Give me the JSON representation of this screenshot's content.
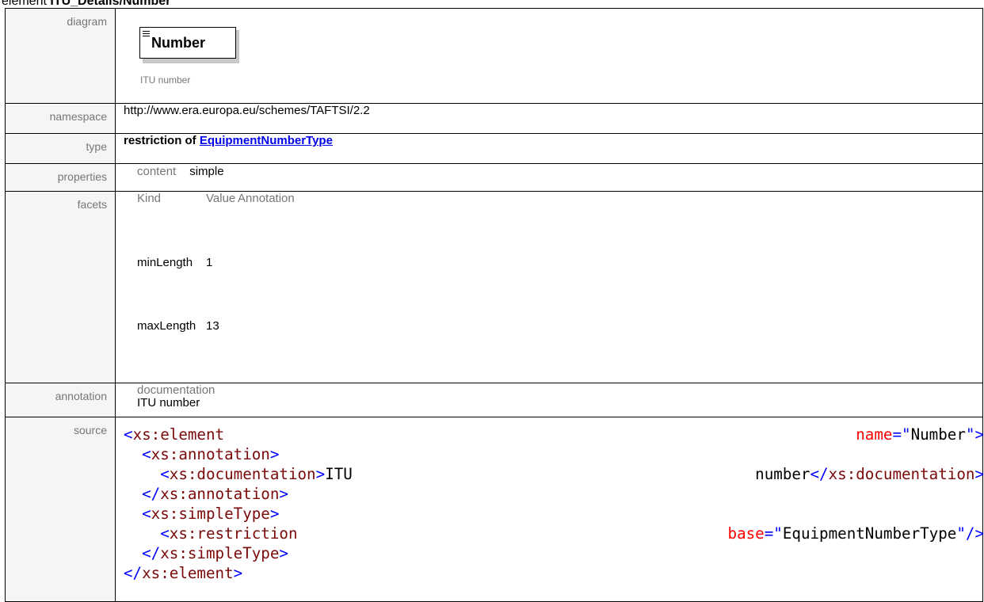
{
  "page_heading": {
    "prefix": "element ",
    "path": "ITU_Details/Number"
  },
  "labels": {
    "diagram": "diagram",
    "namespace": "namespace",
    "type": "type",
    "properties": "properties",
    "facets": "facets",
    "annotation": "annotation",
    "source": "source"
  },
  "diagram": {
    "element_name": "Number",
    "documentation": "ITU number"
  },
  "namespace": "http://www.era.europa.eu/schemes/TAFTSI/2.2",
  "type": {
    "prefix": "restriction of ",
    "link": "EquipmentNumberType"
  },
  "properties": {
    "key": "content",
    "value": "simple"
  },
  "facets": {
    "headers": [
      "Kind",
      "Value",
      "Annotation"
    ],
    "rows": [
      {
        "kind": "minLength",
        "value": "1",
        "annotation": ""
      },
      {
        "kind": "maxLength",
        "value": "13",
        "annotation": ""
      }
    ]
  },
  "annotation": {
    "key": "documentation",
    "value": "ITU number"
  },
  "source": {
    "l1_open": "<",
    "l1_tag": "xs:element",
    "l1_attr": "name",
    "l1_eq": "=\"",
    "l1_val": "Number",
    "l1_close": "\">",
    "l2_indent": "  ",
    "l2_open": "<",
    "l2_tag": "xs:annotation",
    "l2_close": ">",
    "l3_indent": "    ",
    "l3_open": "<",
    "l3_tag": "xs:documentation",
    "l3_close": ">",
    "l3_text1": "ITU",
    "l3_text2": "number",
    "l3_end_open": "</",
    "l3_end_tag": "xs:documentation",
    "l3_end_close": ">",
    "l4_indent": "  ",
    "l4_open": "</",
    "l4_tag": "xs:annotation",
    "l4_close": ">",
    "l5_indent": "  ",
    "l5_open": "<",
    "l5_tag": "xs:simpleType",
    "l5_close": ">",
    "l6_indent": "    ",
    "l6_open": "<",
    "l6_tag": "xs:restriction",
    "l6_attr": "base",
    "l6_eq": "=\"",
    "l6_val": "EquipmentNumberType",
    "l6_close": "\"/>",
    "l7_indent": "  ",
    "l7_open": "</",
    "l7_tag": "xs:simpleType",
    "l7_close": ">",
    "l8_open": "</",
    "l8_tag": "xs:element",
    "l8_close": ">"
  }
}
